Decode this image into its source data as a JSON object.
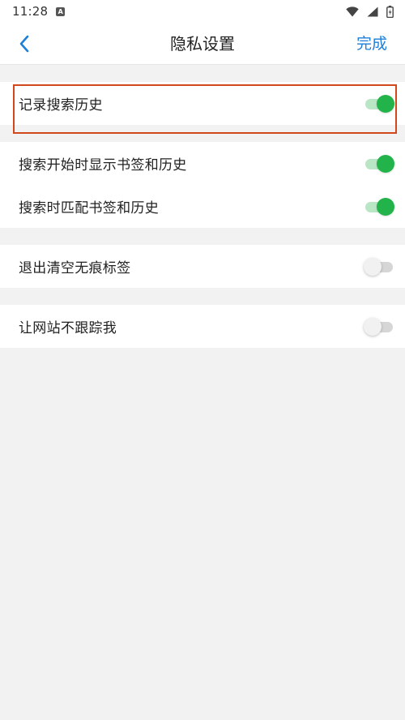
{
  "status_bar": {
    "time": "11:28",
    "notification_icon": "A"
  },
  "nav": {
    "title": "隐私设置",
    "done_label": "完成",
    "back_icon": "chevron-left-icon"
  },
  "settings": {
    "record_history": {
      "label": "记录搜索历史",
      "enabled": true
    },
    "show_bookmarks_history": {
      "label": "搜索开始时显示书签和历史",
      "enabled": true
    },
    "match_bookmarks_history": {
      "label": "搜索时匹配书签和历史",
      "enabled": true
    },
    "clear_incognito_tabs": {
      "label": "退出清空无痕标签",
      "enabled": false
    },
    "do_not_track": {
      "label": "让网站不跟踪我",
      "enabled": false
    }
  },
  "colors": {
    "accent": "#1e7fd8",
    "toggle_on": "#22b34a",
    "highlight": "#d0481c"
  }
}
